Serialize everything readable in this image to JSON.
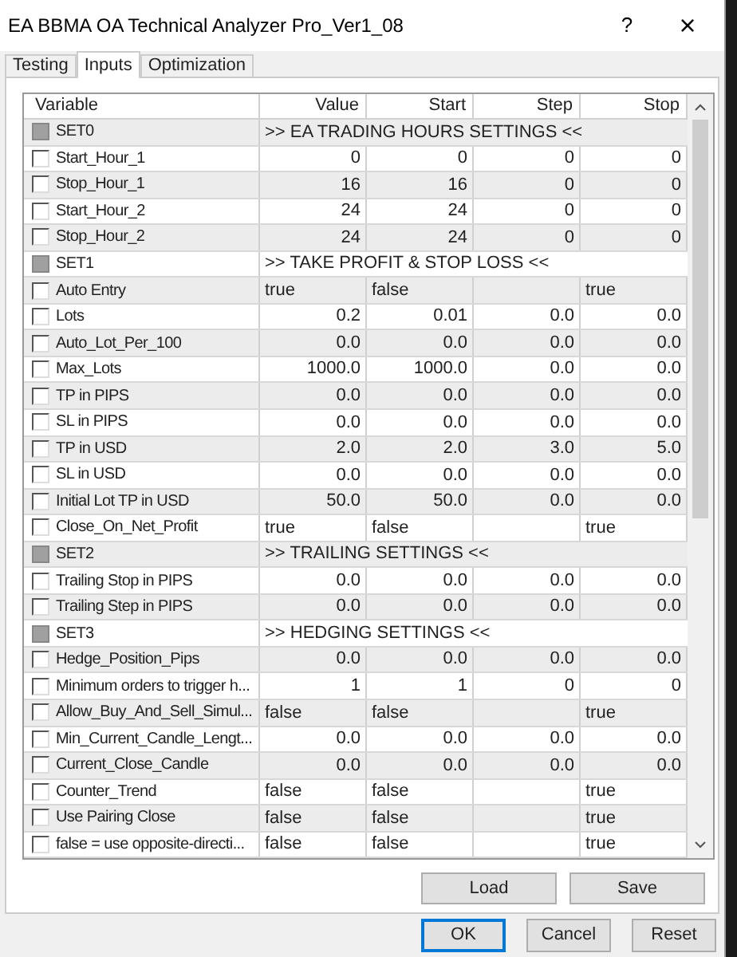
{
  "window": {
    "title": "EA BBMA OA Technical Analyzer Pro_Ver1_08",
    "help": "?",
    "close": "×"
  },
  "tabs": [
    {
      "label": "Testing",
      "selected": false
    },
    {
      "label": "Inputs",
      "selected": true
    },
    {
      "label": "Optimization",
      "selected": false
    }
  ],
  "table": {
    "columns": [
      "Variable",
      "Value",
      "Start",
      "Step",
      "Stop"
    ],
    "rows": [
      {
        "kind": "group",
        "disabled": true,
        "name": "SET0",
        "value": ">> EA TRADING HOURS SETTINGS <<"
      },
      {
        "kind": "number",
        "checked": false,
        "disabled": false,
        "name": "Start_Hour_1",
        "cells": [
          "0",
          "0",
          "0",
          "0"
        ]
      },
      {
        "kind": "number",
        "checked": false,
        "disabled": false,
        "name": "Stop_Hour_1",
        "cells": [
          "16",
          "16",
          "0",
          "0"
        ]
      },
      {
        "kind": "number",
        "checked": false,
        "disabled": false,
        "name": "Start_Hour_2",
        "cells": [
          "24",
          "24",
          "0",
          "0"
        ]
      },
      {
        "kind": "number",
        "checked": false,
        "disabled": false,
        "name": "Stop_Hour_2",
        "cells": [
          "24",
          "24",
          "0",
          "0"
        ]
      },
      {
        "kind": "group",
        "disabled": true,
        "name": "SET1",
        "value": ">> TAKE PROFIT & STOP LOSS <<"
      },
      {
        "kind": "bool",
        "checked": false,
        "disabled": false,
        "name": "Auto Entry",
        "cells": [
          "true",
          "false",
          "",
          "true"
        ]
      },
      {
        "kind": "number",
        "checked": false,
        "disabled": false,
        "name": "Lots",
        "cells": [
          "0.2",
          "0.01",
          "0.0",
          "0.0"
        ]
      },
      {
        "kind": "number",
        "checked": false,
        "disabled": false,
        "name": "Auto_Lot_Per_100",
        "cells": [
          "0.0",
          "0.0",
          "0.0",
          "0.0"
        ]
      },
      {
        "kind": "number",
        "checked": false,
        "disabled": false,
        "name": "Max_Lots",
        "cells": [
          "1000.0",
          "1000.0",
          "0.0",
          "0.0"
        ]
      },
      {
        "kind": "number",
        "checked": false,
        "disabled": false,
        "name": "TP in PIPS",
        "cells": [
          "0.0",
          "0.0",
          "0.0",
          "0.0"
        ]
      },
      {
        "kind": "number",
        "checked": false,
        "disabled": false,
        "name": "SL in PIPS",
        "cells": [
          "0.0",
          "0.0",
          "0.0",
          "0.0"
        ]
      },
      {
        "kind": "number",
        "checked": false,
        "disabled": false,
        "name": "TP in USD",
        "cells": [
          "2.0",
          "2.0",
          "3.0",
          "5.0"
        ]
      },
      {
        "kind": "number",
        "checked": false,
        "disabled": false,
        "name": "SL in USD",
        "cells": [
          "0.0",
          "0.0",
          "0.0",
          "0.0"
        ]
      },
      {
        "kind": "number",
        "checked": false,
        "disabled": false,
        "name": "Initial Lot TP in USD",
        "cells": [
          "50.0",
          "50.0",
          "0.0",
          "0.0"
        ]
      },
      {
        "kind": "bool",
        "checked": false,
        "disabled": false,
        "name": "Close_On_Net_Profit",
        "cells": [
          "true",
          "false",
          "",
          "true"
        ]
      },
      {
        "kind": "group",
        "disabled": true,
        "name": "SET2",
        "value": ">> TRAILING SETTINGS <<"
      },
      {
        "kind": "number",
        "checked": false,
        "disabled": false,
        "name": "Trailing Stop in PIPS",
        "cells": [
          "0.0",
          "0.0",
          "0.0",
          "0.0"
        ]
      },
      {
        "kind": "number",
        "checked": false,
        "disabled": false,
        "name": "Trailing Step in PIPS",
        "cells": [
          "0.0",
          "0.0",
          "0.0",
          "0.0"
        ]
      },
      {
        "kind": "group",
        "disabled": true,
        "name": "SET3",
        "value": ">> HEDGING SETTINGS <<"
      },
      {
        "kind": "number",
        "checked": false,
        "disabled": false,
        "name": "Hedge_Position_Pips",
        "cells": [
          "0.0",
          "0.0",
          "0.0",
          "0.0"
        ]
      },
      {
        "kind": "number",
        "checked": false,
        "disabled": false,
        "name": "Minimum orders to trigger h...",
        "cells": [
          "1",
          "1",
          "0",
          "0"
        ]
      },
      {
        "kind": "bool",
        "checked": false,
        "disabled": false,
        "name": "Allow_Buy_And_Sell_Simul...",
        "cells": [
          "false",
          "false",
          "",
          "true"
        ]
      },
      {
        "kind": "number",
        "checked": false,
        "disabled": false,
        "name": "Min_Current_Candle_Lengt...",
        "cells": [
          "0.0",
          "0.0",
          "0.0",
          "0.0"
        ]
      },
      {
        "kind": "number",
        "checked": false,
        "disabled": false,
        "name": "Current_Close_Candle",
        "cells": [
          "0.0",
          "0.0",
          "0.0",
          "0.0"
        ]
      },
      {
        "kind": "bool",
        "checked": false,
        "disabled": false,
        "name": "Counter_Trend",
        "cells": [
          "false",
          "false",
          "",
          "true"
        ]
      },
      {
        "kind": "bool",
        "checked": false,
        "disabled": false,
        "name": "Use Pairing Close",
        "cells": [
          "false",
          "false",
          "",
          "true"
        ]
      },
      {
        "kind": "bool",
        "checked": false,
        "disabled": false,
        "name": "false = use opposite-directi...",
        "cells": [
          "false",
          "false",
          "",
          "true"
        ]
      }
    ]
  },
  "panel_buttons": [
    "Load",
    "Save"
  ],
  "dialog_buttons": [
    {
      "label": "OK",
      "default": true
    },
    {
      "label": "Cancel",
      "default": false
    },
    {
      "label": "Reset",
      "default": false
    }
  ]
}
